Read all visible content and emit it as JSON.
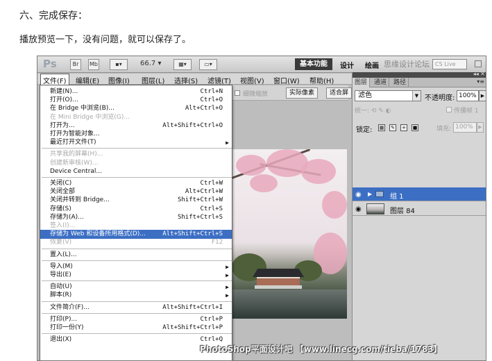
{
  "article": {
    "heading": "六、完成保存：",
    "description": "播放预览一下，没有问题，就可以保存了。"
  },
  "toolbar": {
    "logo": "Ps",
    "bridge_btn": "Br",
    "minibridge_btn": "Mb",
    "zoom": "66.7",
    "workspace_active": "基本功能",
    "workspace_design": "设计",
    "workspace_paint": "绘画",
    "cs_live": "CS Live"
  },
  "menubar": [
    {
      "label": "文件(F)",
      "open": true
    },
    {
      "label": "编辑(E)"
    },
    {
      "label": "图像(I)"
    },
    {
      "label": "图层(L)"
    },
    {
      "label": "选择(S)"
    },
    {
      "label": "滤镜(T)"
    },
    {
      "label": "视图(V)"
    },
    {
      "label": "窗口(W)"
    },
    {
      "label": "帮助(H)"
    }
  ],
  "options_bar": {
    "scrubby_zoom": "细微缩放",
    "actual_pixels": "实际像素",
    "fit_screen": "适合屏"
  },
  "file_menu": [
    {
      "label": "新建(N)...",
      "shortcut": "Ctrl+N"
    },
    {
      "label": "打开(O)...",
      "shortcut": "Ctrl+O"
    },
    {
      "label": "在 Bridge 中浏览(B)...",
      "shortcut": "Alt+Ctrl+O"
    },
    {
      "label": "在 Mini Bridge 中浏览(G)...",
      "shortcut": "",
      "disabled": true
    },
    {
      "label": "打开为...",
      "shortcut": "Alt+Shift+Ctrl+O"
    },
    {
      "label": "打开为智能对象...",
      "shortcut": ""
    },
    {
      "label": "最近打开文件(T)",
      "shortcut": "",
      "submenu": true
    },
    {
      "separator": true
    },
    {
      "label": "共享我的屏幕(H)...",
      "shortcut": "",
      "disabled": true
    },
    {
      "label": "创建新审核(W)...",
      "shortcut": "",
      "disabled": true
    },
    {
      "label": "Device Central...",
      "shortcut": ""
    },
    {
      "separator": true
    },
    {
      "label": "关闭(C)",
      "shortcut": "Ctrl+W"
    },
    {
      "label": "关闭全部",
      "shortcut": "Alt+Ctrl+W"
    },
    {
      "label": "关闭并转到 Bridge...",
      "shortcut": "Shift+Ctrl+W"
    },
    {
      "label": "存储(S)",
      "shortcut": "Ctrl+S"
    },
    {
      "label": "存储为(A)...",
      "shortcut": "Shift+Ctrl+S"
    },
    {
      "label": "签入(I)...",
      "shortcut": "",
      "disabled": true
    },
    {
      "label": "存储为 Web 和设备所用格式(D)...",
      "shortcut": "Alt+Shift+Ctrl+S",
      "highlighted": true
    },
    {
      "label": "恢复(V)",
      "shortcut": "F12",
      "disabled": true
    },
    {
      "separator": true
    },
    {
      "label": "置入(L)...",
      "shortcut": ""
    },
    {
      "separator": true
    },
    {
      "label": "导入(M)",
      "shortcut": "",
      "submenu": true
    },
    {
      "label": "导出(E)",
      "shortcut": "",
      "submenu": true
    },
    {
      "separator": true
    },
    {
      "label": "自动(U)",
      "shortcut": "",
      "submenu": true
    },
    {
      "label": "脚本(R)",
      "shortcut": "",
      "submenu": true
    },
    {
      "separator": true
    },
    {
      "label": "文件简介(F)...",
      "shortcut": "Alt+Shift+Ctrl+I"
    },
    {
      "separator": true
    },
    {
      "label": "打印(P)...",
      "shortcut": "Ctrl+P"
    },
    {
      "label": "打印一份(Y)",
      "shortcut": "Alt+Shift+Ctrl+P"
    },
    {
      "separator": true
    },
    {
      "label": "退出(X)",
      "shortcut": "Ctrl+Q"
    }
  ],
  "layers_panel": {
    "tabs": [
      "图层",
      "通道",
      "路径"
    ],
    "blend_mode": "滤色",
    "opacity_label": "不透明度:",
    "opacity_value": "100%",
    "unify_label": "统一:",
    "propagate_label": "传播帧 1",
    "lock_label": "锁定:",
    "fill_label": "填充:",
    "fill_value": "100%",
    "layers": [
      {
        "name": "组 1",
        "type": "group",
        "selected": true
      },
      {
        "name": "图层 84",
        "type": "layer",
        "selected": false
      }
    ]
  },
  "watermarks": {
    "top": "思缘设计论坛",
    "bottom": "PhotoShop平面设计吧 【www.linecg.com/tieba/1783】"
  },
  "colors": {
    "highlight": "#3c6fc4",
    "workspace_active_bg": "#3b3b3b"
  }
}
